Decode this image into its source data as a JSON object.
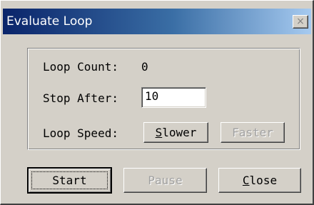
{
  "window": {
    "title": "Evaluate Loop",
    "close_glyph": "×"
  },
  "fields": {
    "loop_count_label": "Loop Count:",
    "loop_count_value": "0",
    "stop_after_label": "Stop After:",
    "stop_after_value": "10",
    "loop_speed_label": "Loop Speed:"
  },
  "speed_buttons": {
    "slower_mnemonic": "S",
    "slower_rest": "lower",
    "faster_label": "Faster",
    "faster_enabled": false
  },
  "actions": {
    "start_label": "Start",
    "pause_label": "Pause",
    "pause_enabled": false,
    "close_mnemonic": "C",
    "close_rest": "lose"
  },
  "colors": {
    "title_gradient_start": "#0a246a",
    "title_gradient_end": "#a6caf0",
    "face": "#d4d0c8",
    "disabled_text": "#a0a0a0"
  }
}
